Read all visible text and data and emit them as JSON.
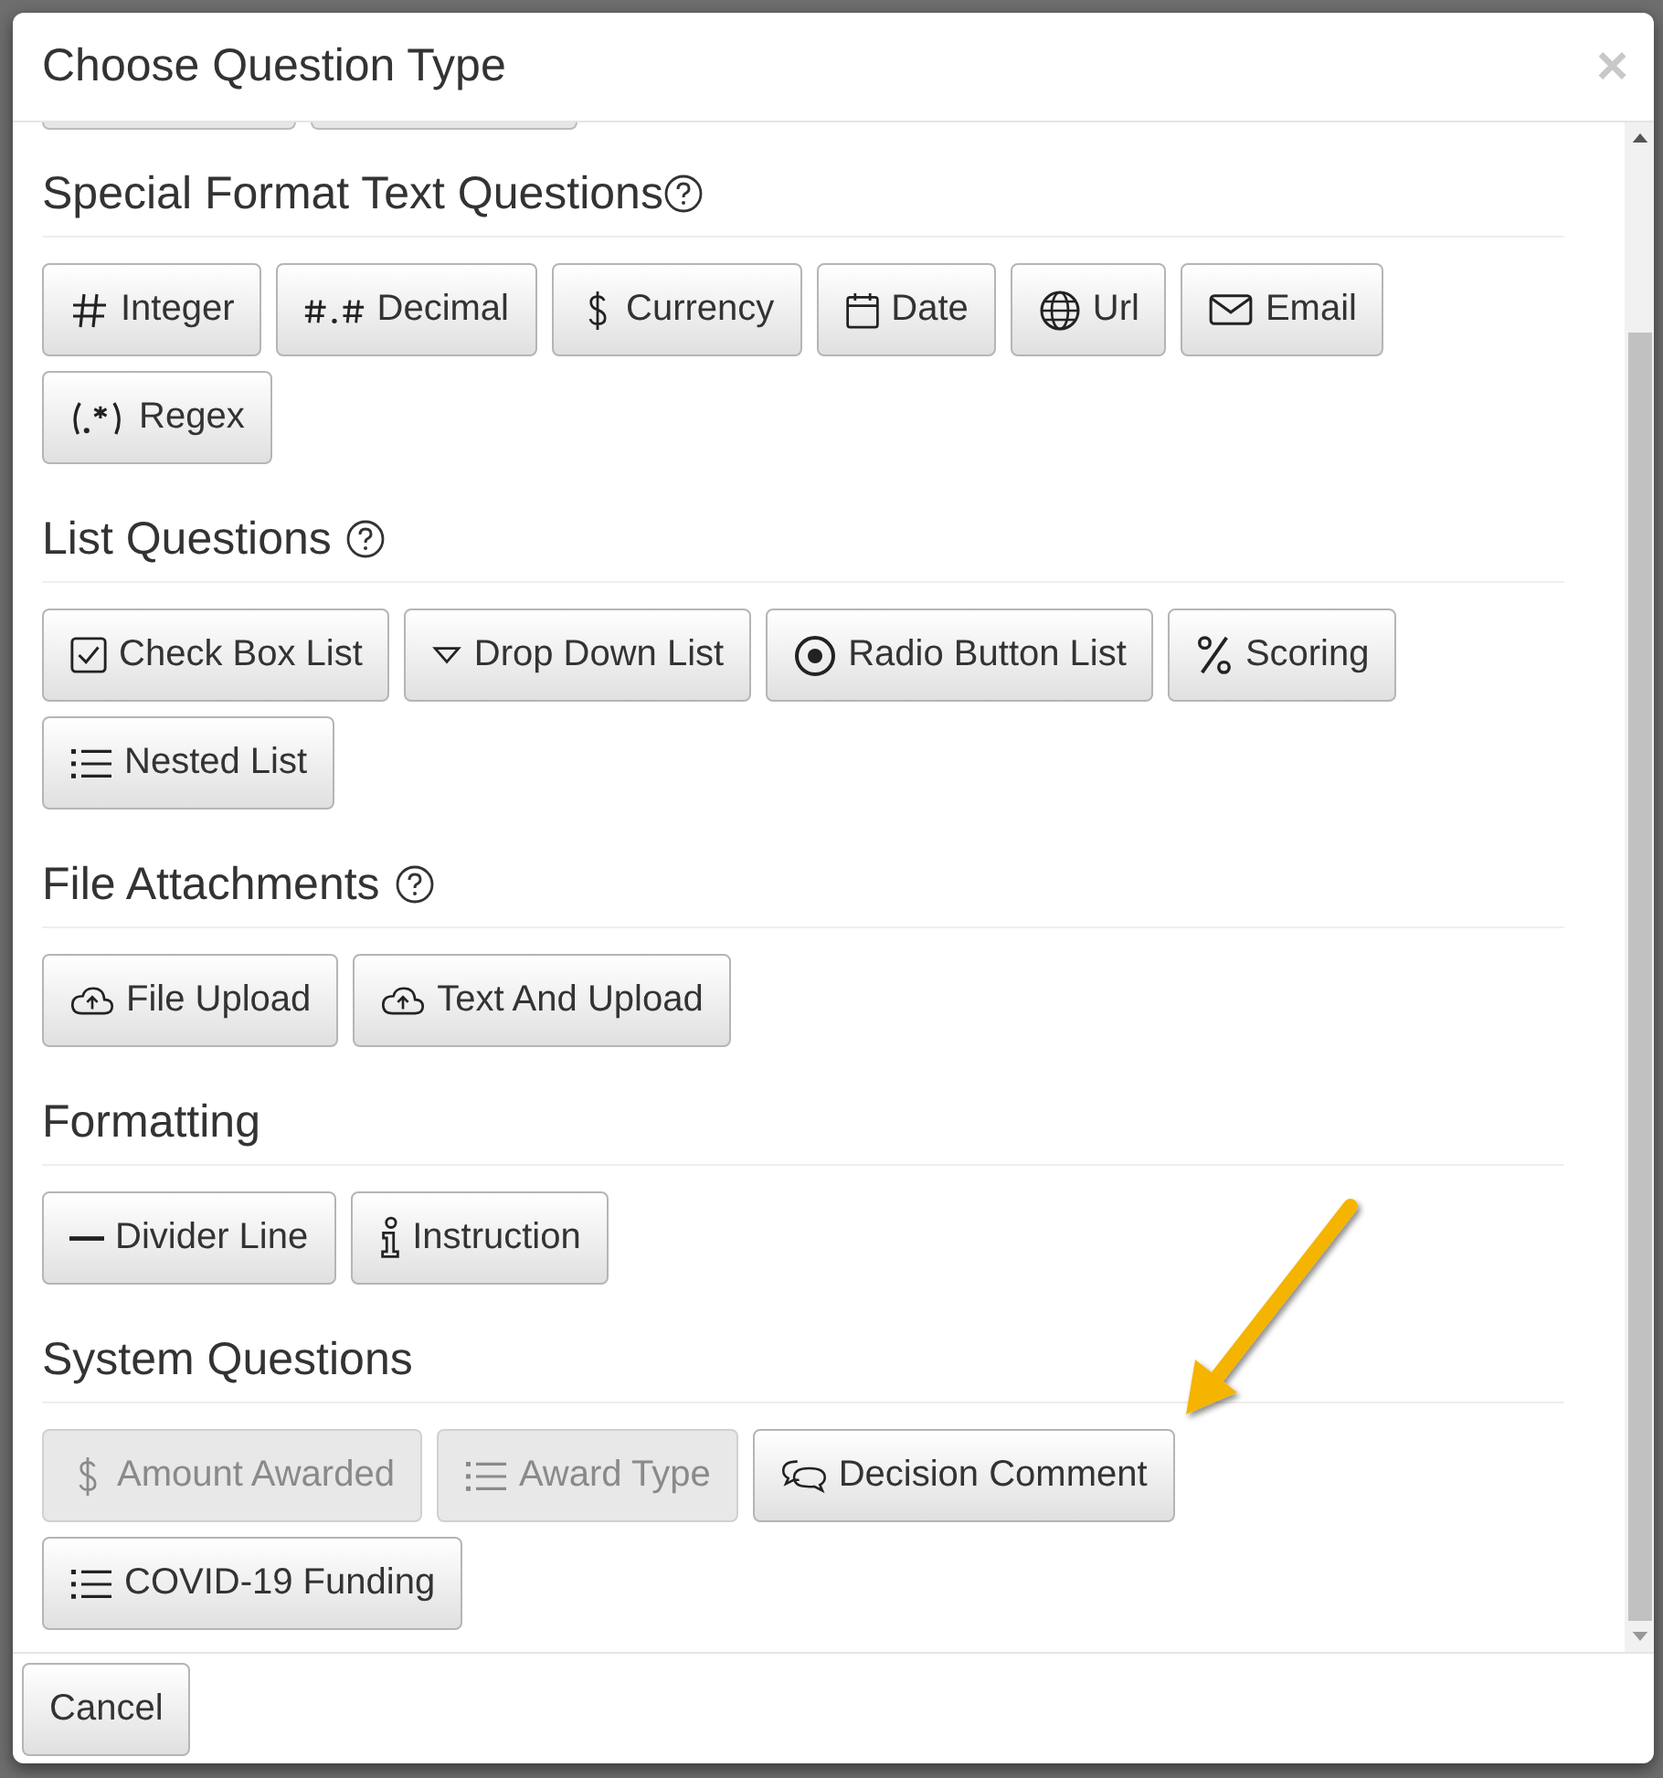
{
  "dialog": {
    "title": "Choose Question Type",
    "close": "×"
  },
  "sections": [
    {
      "heading": "Special Format Text Questions",
      "help": true,
      "buttons": [
        {
          "label": "Integer",
          "kind": "hash",
          "disabled": false
        },
        {
          "label": "Decimal",
          "kind": "decimal",
          "disabled": false
        },
        {
          "label": "Currency",
          "kind": "dollar",
          "disabled": false
        },
        {
          "label": "Date",
          "kind": "calendar",
          "disabled": false
        },
        {
          "label": "Url",
          "kind": "globe",
          "disabled": false
        },
        {
          "label": "Email",
          "kind": "envelope",
          "disabled": false
        },
        {
          "label": "Regex",
          "kind": "regex",
          "disabled": false
        }
      ]
    },
    {
      "heading": "List Questions",
      "help": true,
      "buttons": [
        {
          "label": "Check Box List",
          "kind": "checkbox",
          "disabled": false
        },
        {
          "label": "Drop Down List",
          "kind": "triangle",
          "disabled": false
        },
        {
          "label": "Radio Button List",
          "kind": "radio",
          "disabled": false
        },
        {
          "label": "Scoring",
          "kind": "percent",
          "disabled": false
        },
        {
          "label": "Nested List",
          "kind": "list",
          "disabled": false
        }
      ]
    },
    {
      "heading": "File Attachments",
      "help": true,
      "buttons": [
        {
          "label": "File Upload",
          "kind": "cloud",
          "disabled": false
        },
        {
          "label": "Text And Upload",
          "kind": "cloud",
          "disabled": false
        }
      ]
    },
    {
      "heading": "Formatting",
      "help": false,
      "buttons": [
        {
          "label": "Divider Line",
          "kind": "dash",
          "disabled": false
        },
        {
          "label": "Instruction",
          "kind": "info",
          "disabled": false
        }
      ]
    },
    {
      "heading": "System Questions",
      "help": false,
      "buttons": [
        {
          "label": "Amount Awarded",
          "kind": "dollar",
          "disabled": true
        },
        {
          "label": "Award Type",
          "kind": "list",
          "disabled": true
        },
        {
          "label": "Decision Comment",
          "kind": "chat",
          "disabled": false
        },
        {
          "label": "COVID-19 Funding",
          "kind": "list",
          "disabled": false
        }
      ]
    }
  ],
  "footer": {
    "cancel": "Cancel"
  }
}
